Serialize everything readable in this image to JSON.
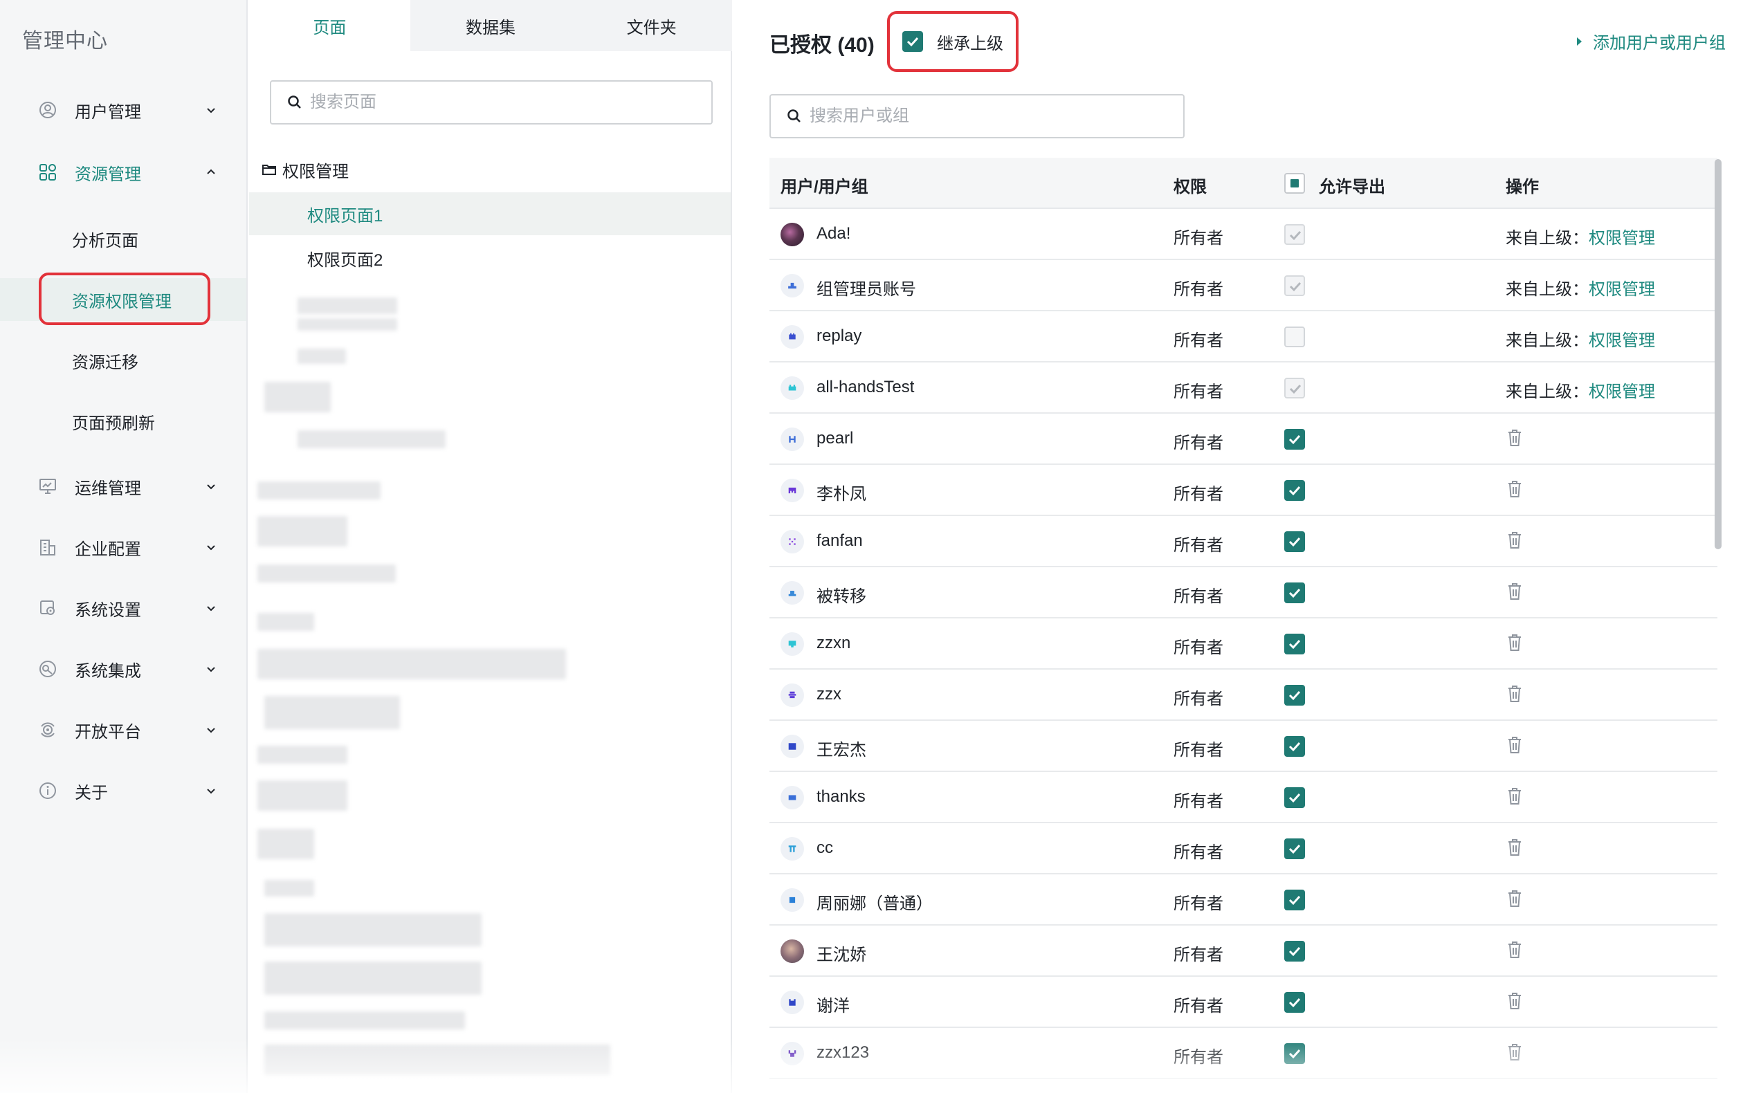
{
  "app": {
    "title": "管理中心"
  },
  "nav": {
    "items": [
      {
        "label": "用户管理",
        "icon": "user-circle-icon",
        "expanded": false
      },
      {
        "label": "资源管理",
        "icon": "grid-icon",
        "expanded": true,
        "children": [
          "分析页面",
          "资源权限管理",
          "资源迁移",
          "页面预刷新"
        ],
        "selected_child": "资源权限管理"
      },
      {
        "label": "运维管理",
        "icon": "monitor-icon",
        "expanded": false
      },
      {
        "label": "企业配置",
        "icon": "building-icon",
        "expanded": false
      },
      {
        "label": "系统设置",
        "icon": "settings-icon",
        "expanded": false
      },
      {
        "label": "系统集成",
        "icon": "integration-icon",
        "expanded": false
      },
      {
        "label": "开放平台",
        "icon": "platform-icon",
        "expanded": false
      },
      {
        "label": "关于",
        "icon": "info-icon",
        "expanded": false
      }
    ]
  },
  "tree": {
    "tabs": [
      "页面",
      "数据集",
      "文件夹"
    ],
    "active_tab": "页面",
    "search_placeholder": "搜索页面",
    "folder": "权限管理",
    "pages": [
      "权限页面1",
      "权限页面2"
    ],
    "selected_page": "权限页面1"
  },
  "main": {
    "title": "已授权 (40)",
    "inherit_label": "继承上级",
    "inherit_checked": true,
    "add_label": "添加用户或用户组",
    "search_placeholder": "搜索用户或组",
    "columns": [
      "用户/用户组",
      "权限",
      "允许导出",
      "操作"
    ],
    "inherit_prefix": "来自上级：",
    "inherit_link": "权限管理",
    "accent_color": "#1f7a73",
    "rows": [
      {
        "name": "Ada!",
        "permission": "所有者",
        "export": "inherited-checked",
        "inherited": true
      },
      {
        "name": "组管理员账号",
        "permission": "所有者",
        "export": "inherited-checked",
        "inherited": true
      },
      {
        "name": "replay",
        "permission": "所有者",
        "export": "inherited-unchecked",
        "inherited": true
      },
      {
        "name": "all-handsTest",
        "permission": "所有者",
        "export": "inherited-checked",
        "inherited": true
      },
      {
        "name": "pearl",
        "permission": "所有者",
        "export": "checked",
        "inherited": false
      },
      {
        "name": "李朴凤",
        "permission": "所有者",
        "export": "checked",
        "inherited": false
      },
      {
        "name": "fanfan",
        "permission": "所有者",
        "export": "checked",
        "inherited": false
      },
      {
        "name": "被转移",
        "permission": "所有者",
        "export": "checked",
        "inherited": false
      },
      {
        "name": "zzxn",
        "permission": "所有者",
        "export": "checked",
        "inherited": false
      },
      {
        "name": "zzx",
        "permission": "所有者",
        "export": "checked",
        "inherited": false
      },
      {
        "name": "王宏杰",
        "permission": "所有者",
        "export": "checked",
        "inherited": false
      },
      {
        "name": "thanks",
        "permission": "所有者",
        "export": "checked",
        "inherited": false
      },
      {
        "name": "cc",
        "permission": "所有者",
        "export": "checked",
        "inherited": false
      },
      {
        "name": "周丽娜（普通）",
        "permission": "所有者",
        "export": "checked",
        "inherited": false
      },
      {
        "name": "王沈娇",
        "permission": "所有者",
        "export": "checked",
        "inherited": false
      },
      {
        "name": "谢洋",
        "permission": "所有者",
        "export": "checked",
        "inherited": false
      },
      {
        "name": "zzx123",
        "permission": "所有者",
        "export": "checked",
        "inherited": false
      }
    ]
  }
}
